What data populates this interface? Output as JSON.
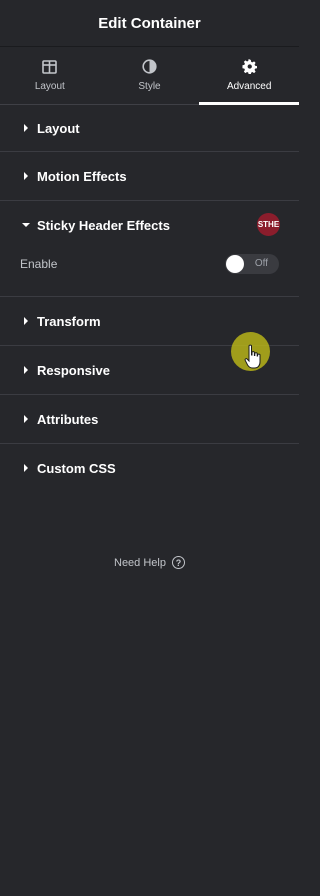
{
  "header": {
    "title": "Edit Container"
  },
  "tabs": [
    {
      "label": "Layout",
      "icon": "columns-icon"
    },
    {
      "label": "Style",
      "icon": "contrast-icon"
    },
    {
      "label": "Advanced",
      "icon": "gear-icon",
      "active": true
    }
  ],
  "sections": {
    "layout": "Layout",
    "motion_effects": "Motion Effects",
    "sticky_header": {
      "title": "Sticky Header Effects",
      "badge": "STHE",
      "enable_label": "Enable",
      "toggle_state": "Off"
    },
    "transform": "Transform",
    "responsive": "Responsive",
    "attributes": "Attributes",
    "custom_css": "Custom CSS"
  },
  "help": {
    "label": "Need Help",
    "icon": "?"
  },
  "colors": {
    "background": "#26272b",
    "badge": "#8b1d2c",
    "cursor_highlight": "#bcb718"
  }
}
